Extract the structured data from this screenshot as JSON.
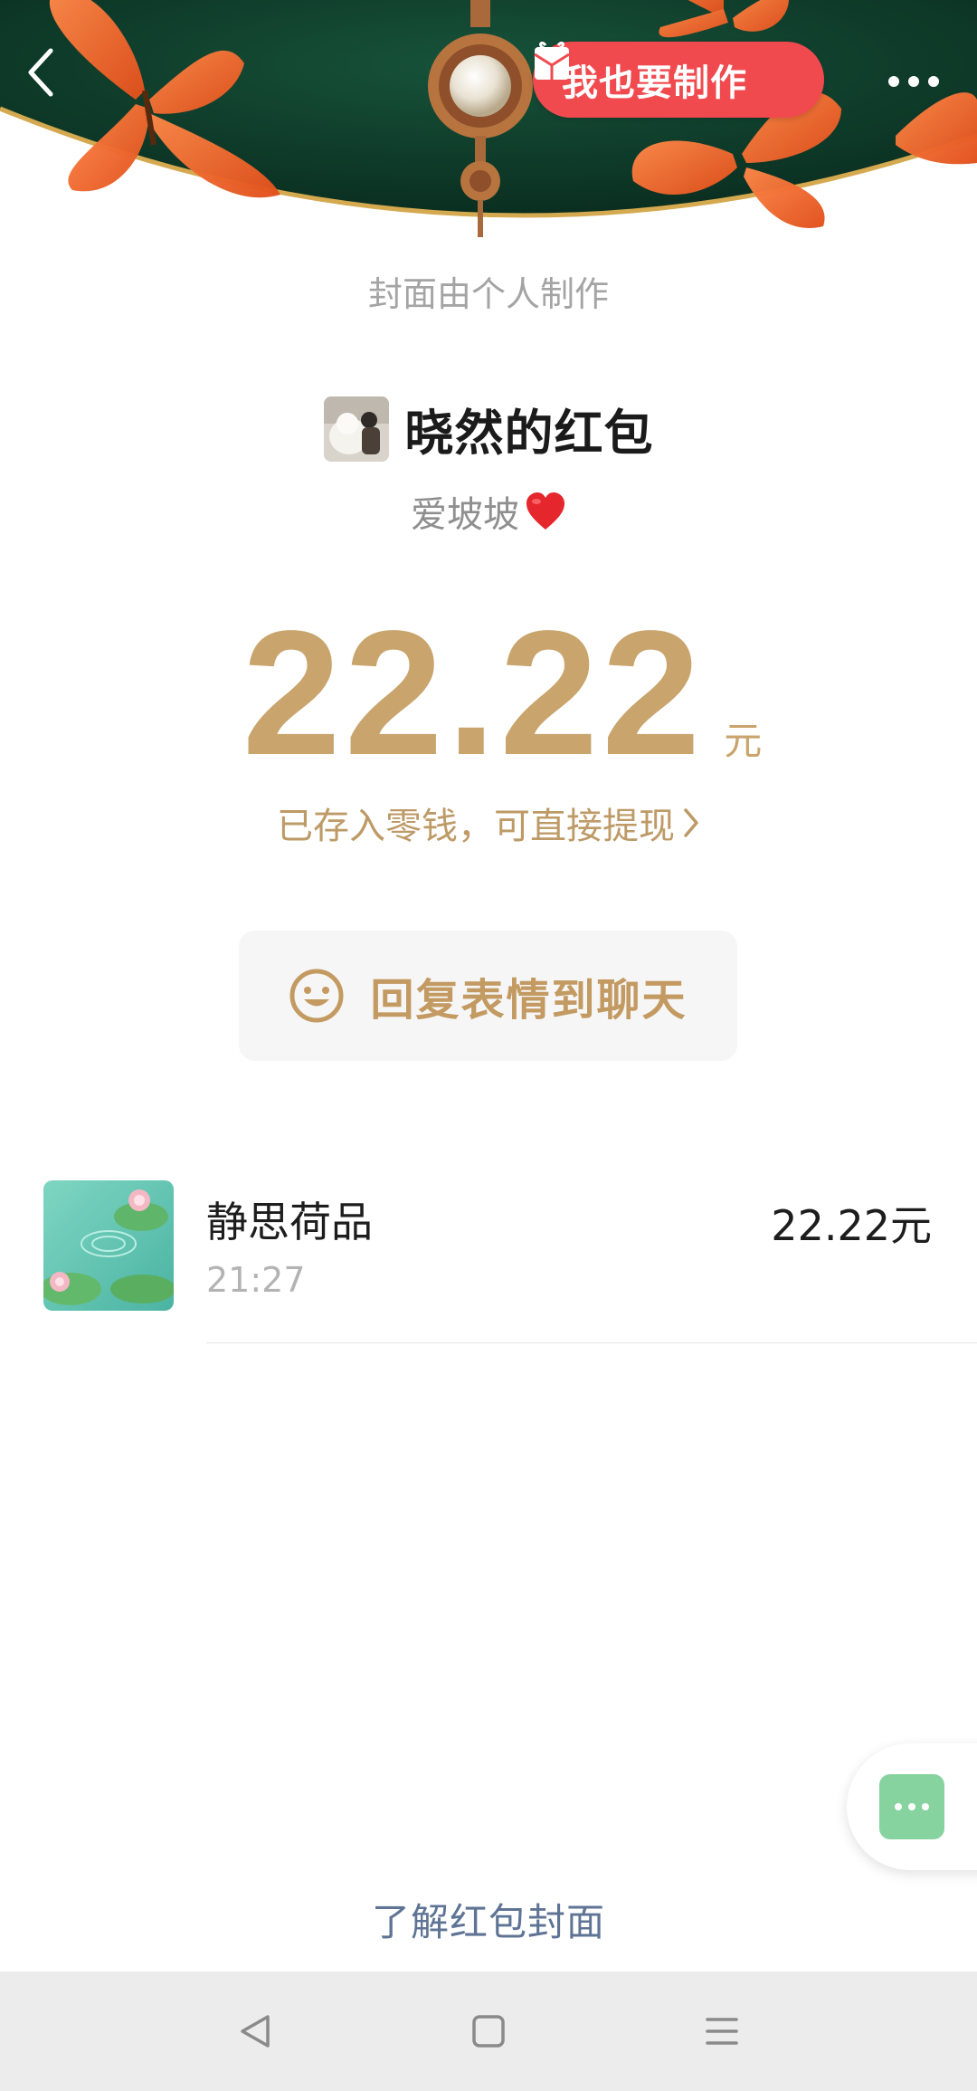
{
  "header": {
    "make_button_label": "我也要制作",
    "back_icon": "chevron-left-icon",
    "more_icon": "more-dots-icon",
    "gift_icon": "gift-envelope-icon"
  },
  "cover_caption": "封面由个人制作",
  "sender": {
    "title": "晓然的红包",
    "greeting": "爱坡坡",
    "greeting_emoji": "❤️"
  },
  "amount": {
    "value": "22.22",
    "unit": "元"
  },
  "deposit_note": "已存入零钱，可直接提现",
  "reply_button_label": "回复表情到聊天",
  "records": [
    {
      "name": "静思荷品",
      "time": "21:27",
      "amount": "22.22元"
    }
  ],
  "learn_link": "了解红包封面",
  "colors": {
    "gold": "#c9a46c",
    "red_button": "#f04a4f",
    "cover_green": "#0e3b2a",
    "float_green": "#87d39f"
  }
}
